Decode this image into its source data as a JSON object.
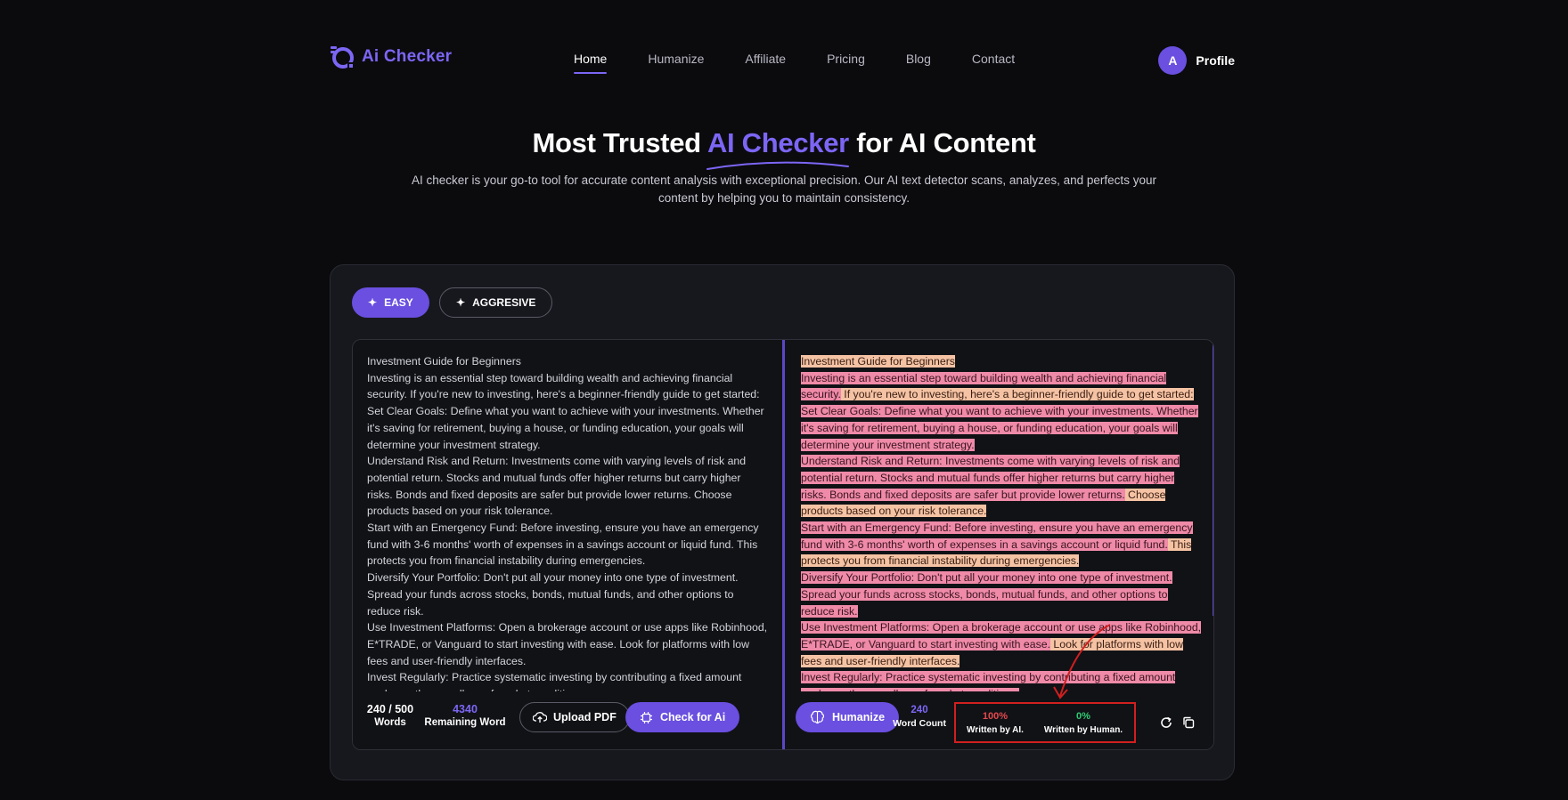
{
  "nav": {
    "logo_text": "Ai Checker",
    "links": [
      "Home",
      "Humanize",
      "Affiliate",
      "Pricing",
      "Blog",
      "Contact"
    ],
    "active": "Home",
    "profile_initial": "A",
    "profile_label": "Profile"
  },
  "hero": {
    "title_pre": "Most Trusted ",
    "title_accent": "AI Checker",
    "title_post": " for AI Content",
    "subtitle": "AI checker is your go-to tool for accurate content analysis with exceptional precision. Our AI text detector scans, analyzes, and perfects your content by helping you to maintain consistency."
  },
  "modes": {
    "easy": "EASY",
    "aggressive": "AGGRESIVE"
  },
  "input_text": [
    "Investment Guide for Beginners",
    "Investing is an essential step toward building wealth and achieving financial security. If you're new to investing, here's a beginner-friendly guide to get started:",
    "Set Clear Goals: Define what you want to achieve with your investments. Whether it's saving for retirement, buying a house, or funding education, your goals will determine your investment strategy.",
    "Understand Risk and Return: Investments come with varying levels of risk and potential return. Stocks and mutual funds offer higher returns but carry higher risks. Bonds and fixed deposits are safer but provide lower returns. Choose products based on your risk tolerance.",
    "Start with an Emergency Fund: Before investing, ensure you have an emergency fund with 3-6 months' worth of expenses in a savings account or liquid fund. This protects you from financial instability during emergencies.",
    "Diversify Your Portfolio: Don't put all your money into one type of investment. Spread your funds across stocks, bonds, mutual funds, and other options to reduce risk.",
    "Use Investment Platforms: Open a brokerage account or use apps like Robinhood, E*TRADE, or Vanguard to start investing with ease. Look for platforms with low fees and user-friendly interfaces.",
    "Invest Regularly: Practice systematic investing by contributing a fixed amount each month, regardless of market conditions."
  ],
  "output_segments": [
    [
      {
        "t": "Investment Guide for Beginners",
        "c": "soft"
      }
    ],
    [
      {
        "t": "Investing is an essential step toward building wealth and achieving financial security.",
        "c": "hl"
      },
      {
        "t": " If you're new to investing, here's a beginner-friendly guide to get started:",
        "c": "soft"
      }
    ],
    [
      {
        "t": "Set Clear Goals: Define what you want to achieve with your investments.",
        "c": "hl"
      },
      {
        "t": " Whether it's saving for retirement, buying a house, or funding education, your goals will determine your investment strategy.",
        "c": "hl"
      }
    ],
    [
      {
        "t": "Understand Risk and Return: Investments come with varying levels of risk and potential return.",
        "c": "hl"
      },
      {
        "t": " Stocks and mutual funds offer higher returns but carry higher risks.",
        "c": "hl"
      },
      {
        "t": " Bonds and fixed deposits are safer but provide lower returns.",
        "c": "hl"
      },
      {
        "t": " Choose products based on your risk tolerance.",
        "c": "soft"
      }
    ],
    [
      {
        "t": "Start with an Emergency Fund: Before investing, ensure you have an emergency fund with 3-6 months' worth of expenses in a savings account or liquid fund.",
        "c": "hl"
      },
      {
        "t": " This protects you from financial instability during emergencies.",
        "c": "soft"
      }
    ],
    [
      {
        "t": "Diversify Your Portfolio: Don't put all your money into one type of investment.",
        "c": "hl"
      },
      {
        "t": " Spread your funds across stocks, bonds, mutual funds, and other options to reduce risk.",
        "c": "hl"
      }
    ],
    [
      {
        "t": "Use Investment Platforms: Open a brokerage account or use apps like Robinhood, E*TRADE, or Vanguard to start investing with ease.",
        "c": "hl"
      },
      {
        "t": " Look for platforms with low fees and user-friendly interfaces.",
        "c": "soft"
      }
    ],
    [
      {
        "t": "Invest Regularly: Practice systematic investing by contributing a fixed amount each month, regardless of market conditions.",
        "c": "hl"
      }
    ]
  ],
  "left_footer": {
    "words_count": "240 / 500",
    "words_label": "Words",
    "remaining_count": "4340",
    "remaining_label": "Remaining Word",
    "upload_label": "Upload PDF",
    "check_label": "Check for Ai"
  },
  "right_footer": {
    "humanize_label": "Humanize",
    "word_count": "240",
    "word_count_label": "Word Count",
    "ai_pct": "100%",
    "ai_label": "Written by AI.",
    "human_pct": "0%",
    "human_label": "Written by Human."
  },
  "colors": {
    "accent": "#6a4fe0",
    "ai_red": "#e5484d",
    "human_green": "#2ecc71",
    "highlight": "#ef8aa8",
    "highlight_soft": "#f5c3a4"
  }
}
